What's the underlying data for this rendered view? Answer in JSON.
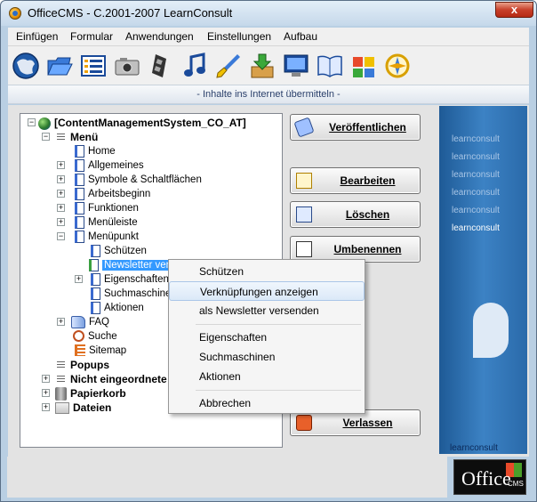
{
  "window": {
    "title": "OfficeCMS - C.2001-2007 LearnConsult",
    "close_label": "x"
  },
  "menubar": [
    "Einfügen",
    "Formular",
    "Anwendungen",
    "Einstellungen",
    "Aufbau"
  ],
  "toolbar": [
    "globe-icon",
    "folder-icon",
    "list-icon",
    "camera-icon",
    "film-icon",
    "music-icon",
    "brush-icon",
    "download-icon",
    "monitor-icon",
    "book-icon",
    "puzzle-icon",
    "compass-icon"
  ],
  "info_bar": {
    "text": "- Inhalte ins Internet übermitteln -"
  },
  "tree": {
    "root": "[ContentManagementSystem_CO_AT]",
    "menu": "Menü",
    "items": {
      "home": "Home",
      "allgemeines": "Allgemeines",
      "symbole": "Symbole & Schaltflächen",
      "arbeitsbeginn": "Arbeitsbeginn",
      "funktionen": "Funktionen",
      "menueleiste": "Menüleiste",
      "menuepunkt": "Menüpunkt",
      "schuetzen": "Schützen",
      "newsletter": "Newsletter ver",
      "eigenschaften": "Eigenschaften",
      "suchmaschinen": "Suchmaschine",
      "aktionen": "Aktionen",
      "faq": "FAQ",
      "suche": "Suche",
      "sitemap": "Sitemap"
    },
    "popups": "Popups",
    "nicht": "Nicht eingeordnete",
    "papierkorb": "Papierkorb",
    "dateien": "Dateien"
  },
  "buttons": {
    "veroeffentlichen": "Veröffentlichen",
    "bearbeiten": "Bearbeiten",
    "loeschen": "Löschen",
    "umbenennen": "Umbenennen",
    "verlassen": "Verlassen"
  },
  "context_menu": {
    "schuetzen": "Schützen",
    "verknuepfungen": "Verknüpfungen anzeigen",
    "newsletter": "als Newsletter versenden",
    "eigenschaften": "Eigenschaften",
    "suchmaschinen": "Suchmaschinen",
    "aktionen": "Aktionen",
    "abbrechen": "Abbrechen"
  },
  "brand": {
    "learnconsult": "learnconsult",
    "office": "Office",
    "cms": "CMS"
  },
  "colors": {
    "accent": "#3399ff",
    "panel": "#2a6aaa"
  }
}
